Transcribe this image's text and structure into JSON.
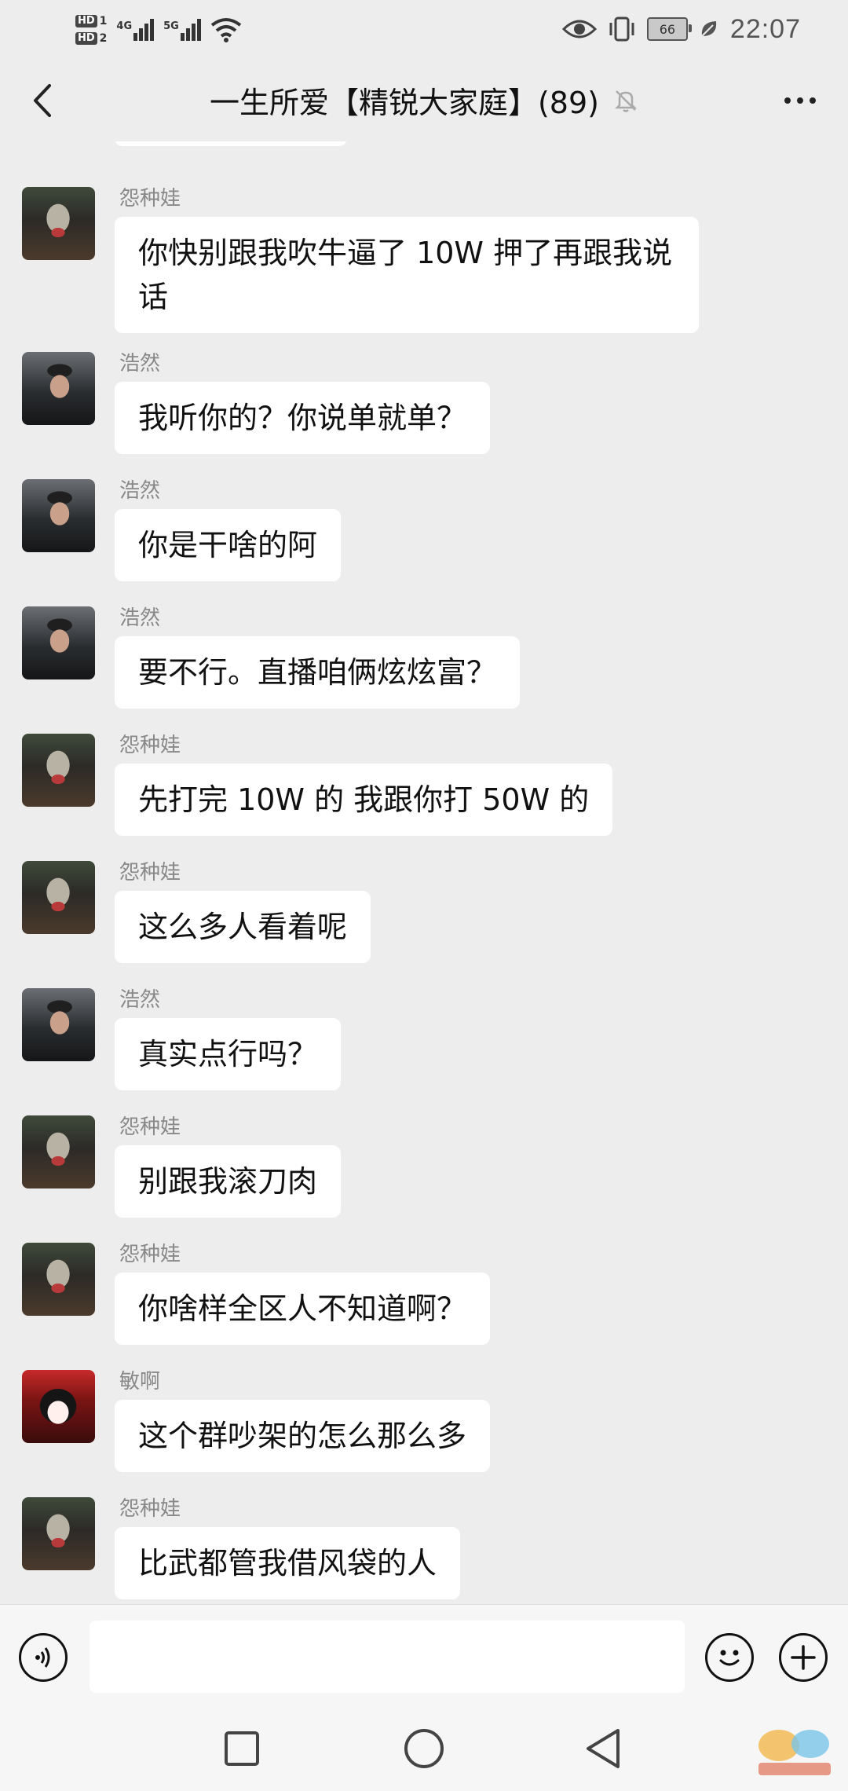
{
  "status_bar": {
    "sim1_badge": "HD",
    "sim1_num": "1",
    "sim2_badge": "HD",
    "sim2_num": "2",
    "net1": "4G",
    "net2": "5G",
    "battery": "66",
    "time": "22:07",
    "icons": [
      "eye-icon",
      "vibrate-icon",
      "battery-icon",
      "leaf-icon",
      "wifi-icon",
      "signal-icon"
    ]
  },
  "header": {
    "title": "一生所爱【精锐大家庭】(89)",
    "icons": [
      "back-arrow-icon",
      "mute-bell-icon",
      "more-dots-icon"
    ]
  },
  "messages": [
    {
      "sender": "怨种娃",
      "text": "你快别跟我吹牛逼了 10W 押了再跟我说话",
      "avatar": "joker"
    },
    {
      "sender": "浩然",
      "text": "我听你的？你说单就单？",
      "avatar": "driver"
    },
    {
      "sender": "浩然",
      "text": "你是干啥的阿",
      "avatar": "driver"
    },
    {
      "sender": "浩然",
      "text": "要不行。直播咱俩炫炫富？",
      "avatar": "driver"
    },
    {
      "sender": "怨种娃",
      "text": "先打完 10W 的 我跟你打 50W 的",
      "avatar": "joker"
    },
    {
      "sender": "怨种娃",
      "text": "这么多人看着呢",
      "avatar": "joker"
    },
    {
      "sender": "浩然",
      "text": "真实点行吗？",
      "avatar": "driver"
    },
    {
      "sender": "怨种娃",
      "text": "别跟我滚刀肉",
      "avatar": "joker"
    },
    {
      "sender": "怨种娃",
      "text": "你啥样全区人不知道啊？",
      "avatar": "joker"
    },
    {
      "sender": "敏啊",
      "text": "这个群吵架的怎么那么多",
      "avatar": "anime"
    },
    {
      "sender": "怨种娃",
      "text": "比武都管我借风袋的人",
      "avatar": "joker"
    }
  ],
  "input": {
    "value": "",
    "placeholder": "",
    "icons": [
      "voice-icon",
      "emoji-icon",
      "plus-icon"
    ]
  },
  "nav": {
    "icons": [
      "recent-apps-icon",
      "home-icon",
      "back-icon"
    ]
  },
  "colors": {
    "background": "#ededed",
    "bubble": "#ffffff",
    "sender_name": "#888888"
  }
}
